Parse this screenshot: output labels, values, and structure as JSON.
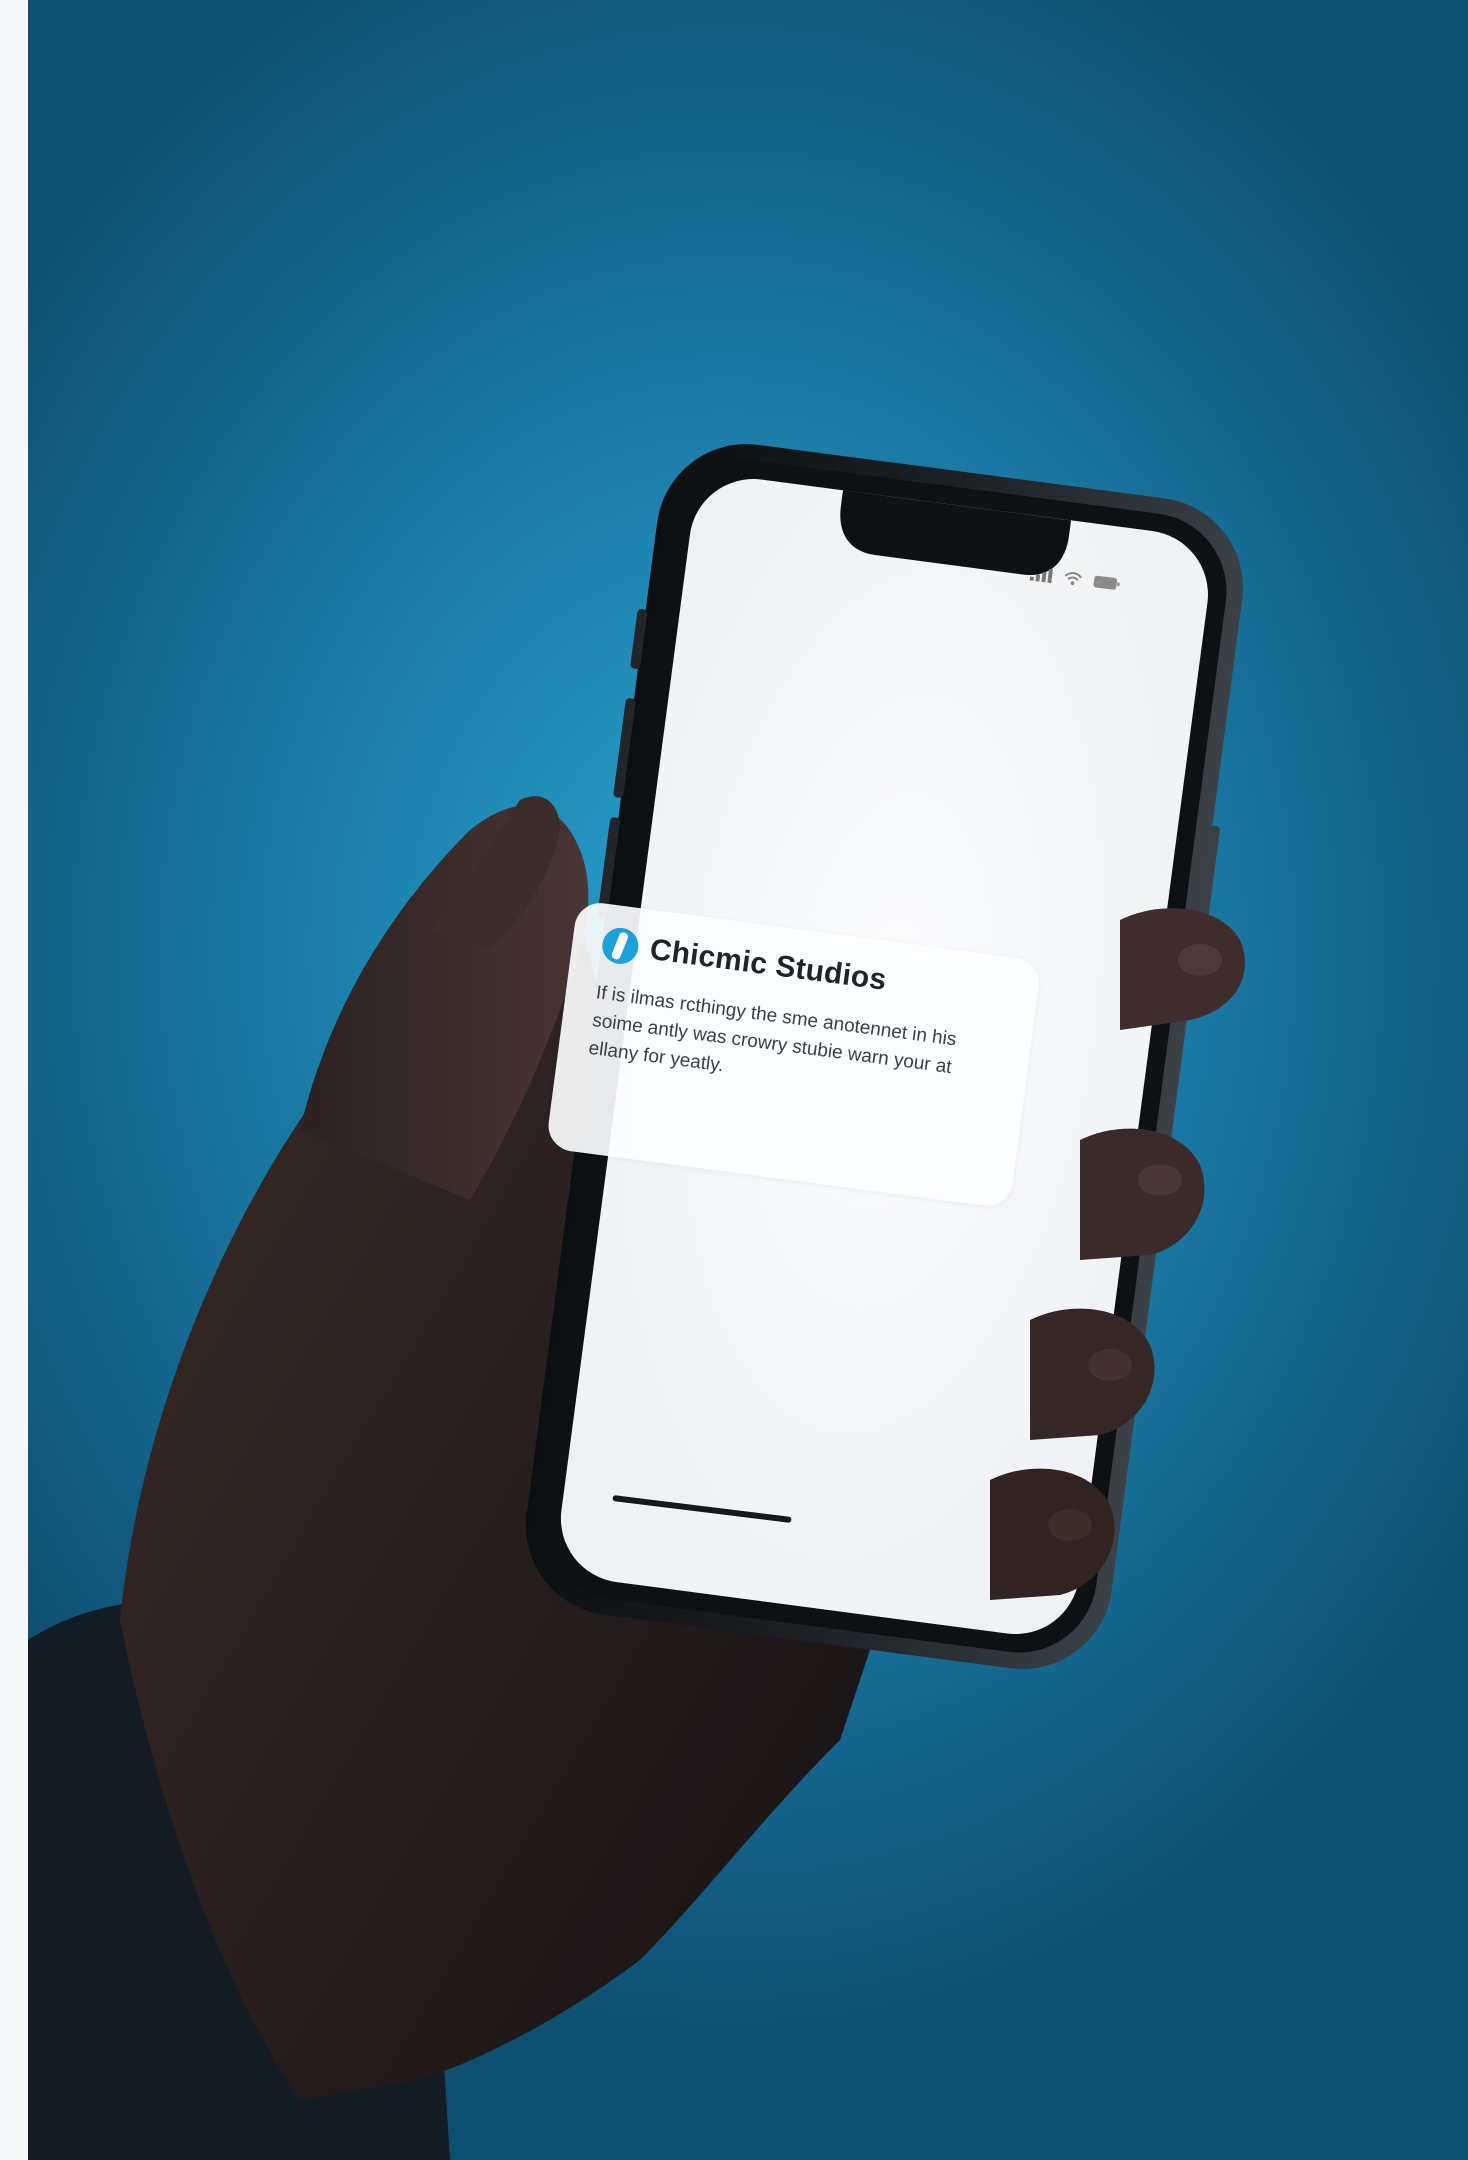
{
  "notification": {
    "app_name": "Chicmic Studios",
    "app_icon": "studio-logo-icon",
    "body": "If is ilmas rcthingy the sme anotennet in his soime antly was crowry stubie warn your at ellany for yeatly."
  },
  "status_bar": {
    "signal_icon": "signal-icon",
    "wifi_icon": "wifi-icon",
    "battery_icon": "battery-icon"
  },
  "colors": {
    "background": "#1f87b3",
    "screen": "#f3f4f6",
    "app_icon": "#1da1d8",
    "frame": "#15191d"
  }
}
